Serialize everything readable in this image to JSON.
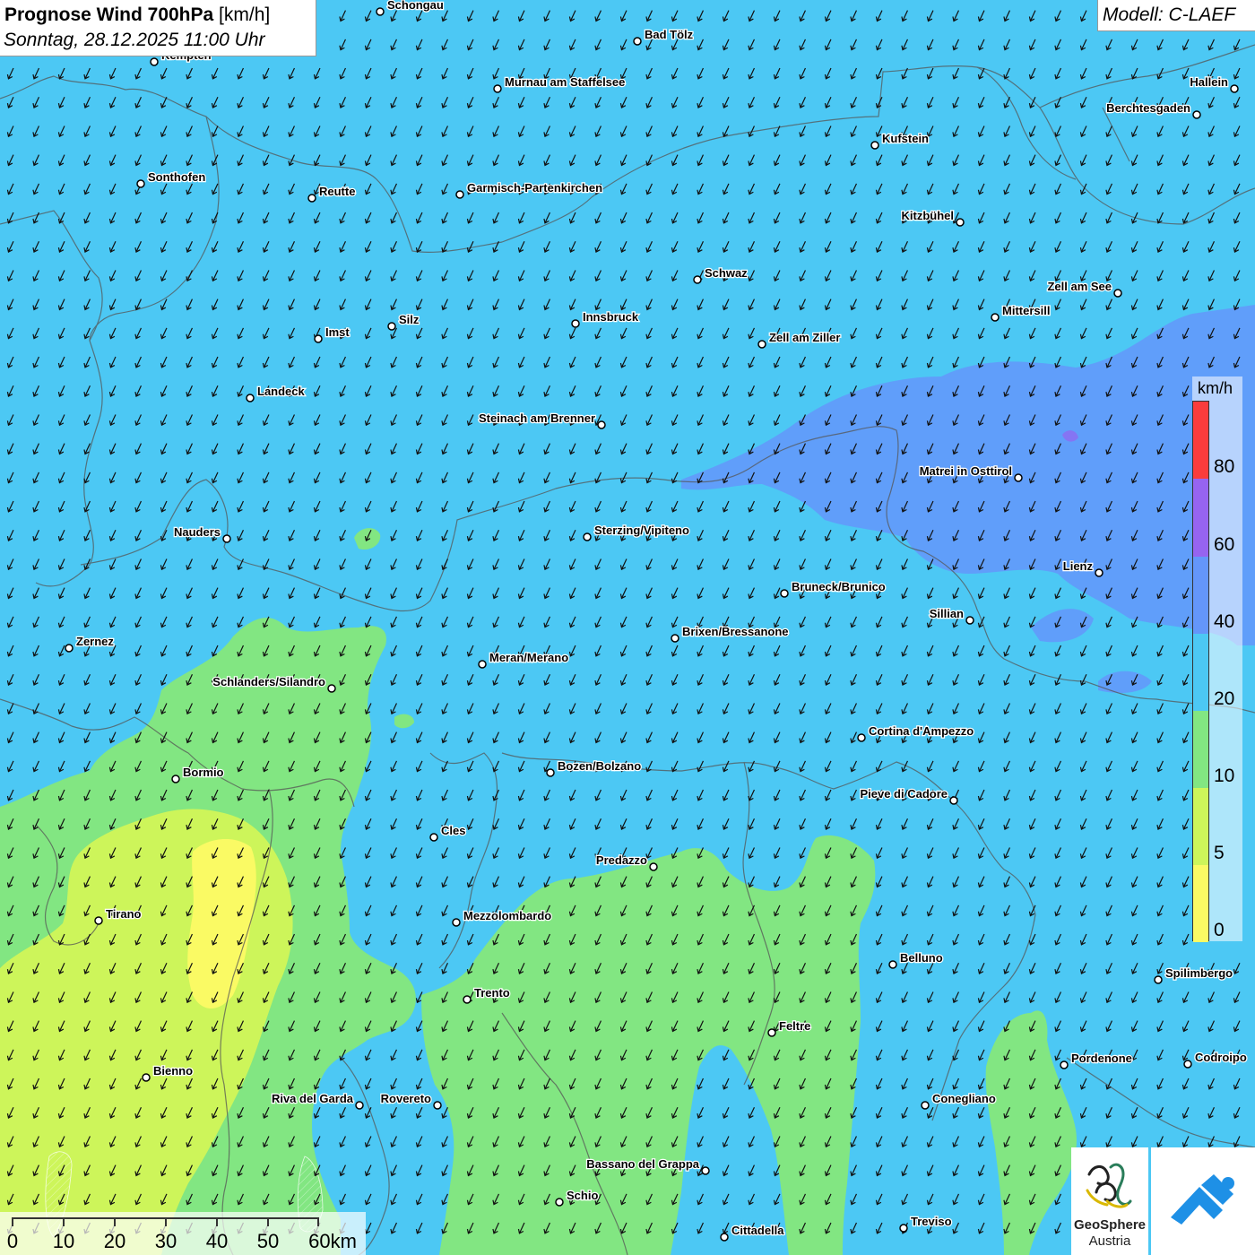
{
  "header": {
    "title": "Prognose Wind 700hPa",
    "unit": "[km/h]",
    "datetime": "Sonntag, 28.12.2025 11:00 Uhr"
  },
  "model": {
    "label": "Modell: C-LAEF"
  },
  "legend": {
    "unit": "km/h",
    "labels": [
      "0",
      "5",
      "10",
      "20",
      "40",
      "60",
      "80"
    ],
    "colors": {
      "below_5": "#fafa64",
      "5_10": "#cdf55a",
      "10_20": "#82e682",
      "20_40": "#4cc8f4",
      "40_60": "#6496fa",
      "60_80": "#9664f0",
      "above_80": "#fa3c3c"
    }
  },
  "scale_bar": {
    "labels": [
      "0",
      "10",
      "20",
      "30",
      "40",
      "50",
      "60km"
    ]
  },
  "logos": {
    "geosphere": {
      "name": "GeoSphere",
      "sub": "Austria",
      "icon": "geosphere-logo-icon"
    },
    "second": {
      "icon": "blue-arrow-logo-icon"
    }
  },
  "map": {
    "wind_direction": "north-northeast",
    "cities": [
      "Schongau",
      "Bad Tölz",
      "Kempten",
      "Murnau am Staffelsee",
      "Hallein",
      "Berchtesgaden",
      "Kufstein",
      "Sonthofen",
      "Reutte",
      "Garmisch-Partenkirchen",
      "Kitzbühel",
      "Schwaz",
      "Zell am See",
      "Mittersill",
      "Silz",
      "Innsbruck",
      "Imst",
      "Zell am Ziller",
      "Landeck",
      "Steinach am Brenner",
      "Matrei in Osttirol",
      "Nauders",
      "Sterzing/Vipiteno",
      "Lienz",
      "Bruneck/Brunico",
      "Sillian",
      "Zernez",
      "Brixen/Bressanone",
      "Meran/Merano",
      "Schlanders/Silandro",
      "Cortina d'Ampezzo",
      "Bozen/Bolzano",
      "Bormio",
      "Pieve di Cadore",
      "Cles",
      "Predazzo",
      "Tirano",
      "Mezzolombardo",
      "Belluno",
      "Spilimbergo",
      "Trento",
      "Feltre",
      "Bienno",
      "Pordenone",
      "Codroipo",
      "Riva del Garda",
      "Rovereto",
      "Conegliano",
      "Bassano del Grappa",
      "Schio",
      "Treviso",
      "Cittadella"
    ]
  }
}
